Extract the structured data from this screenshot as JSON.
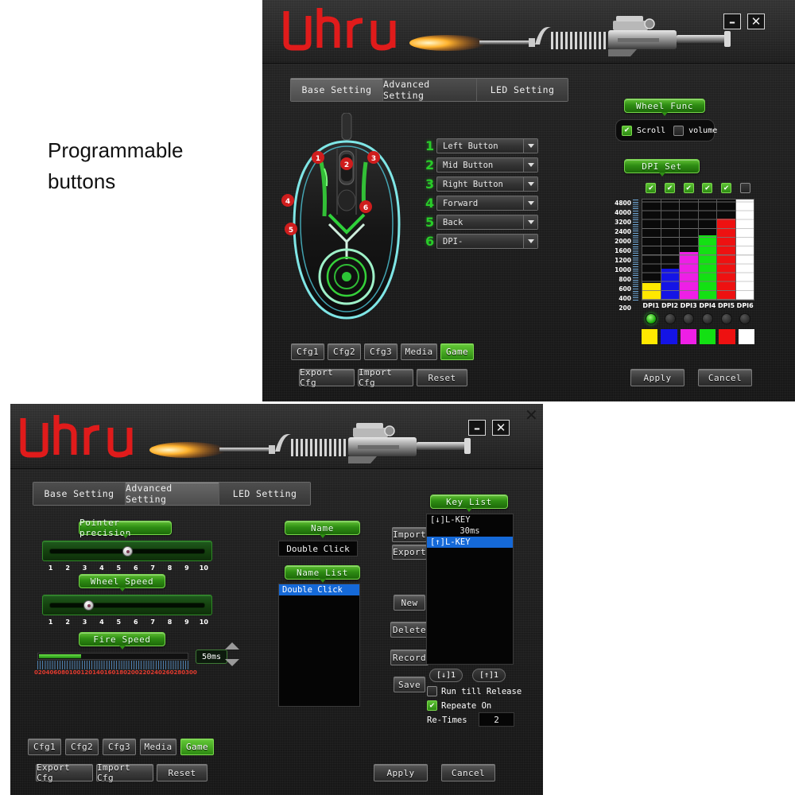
{
  "callout": {
    "line1": "Programmable",
    "line2": "buttons"
  },
  "window_top": {
    "brand": "uhru",
    "controls": {
      "minimize": "–",
      "close": "✕"
    },
    "tabs": [
      {
        "label": "Base Setting",
        "active": true
      },
      {
        "label": "Advanced Setting",
        "active": false
      },
      {
        "label": "LED Setting",
        "active": false
      }
    ],
    "button_rows": [
      {
        "num": "1",
        "value": "Left Button"
      },
      {
        "num": "2",
        "value": "Mid Button"
      },
      {
        "num": "3",
        "value": "Right Button"
      },
      {
        "num": "4",
        "value": "Forward"
      },
      {
        "num": "5",
        "value": "Back"
      },
      {
        "num": "6",
        "value": "DPI-"
      }
    ],
    "mouse_markers": [
      "1",
      "2",
      "3",
      "4",
      "5",
      "6"
    ],
    "wheel_func": {
      "title": "Wheel Func",
      "scroll_label": "Scroll",
      "scroll_checked": true,
      "volume_label": "volume",
      "volume_checked": false
    },
    "dpi_set": {
      "title": "DPI Set"
    },
    "footer": {
      "cfg_buttons": [
        {
          "label": "Cfg1",
          "active": false
        },
        {
          "label": "Cfg2",
          "active": false
        },
        {
          "label": "Cfg3",
          "active": false
        },
        {
          "label": "Media",
          "active": false
        },
        {
          "label": "Game",
          "active": true
        }
      ],
      "export_cfg": "Export Cfg",
      "import_cfg": "Import Cfg",
      "reset": "Reset",
      "apply": "Apply",
      "cancel": "Cancel"
    }
  },
  "window_bottom": {
    "brand": "uhru",
    "controls": {
      "minimize": "–",
      "close": "✕",
      "outer_close": "✕"
    },
    "tabs": [
      {
        "label": "Base Setting",
        "active": false
      },
      {
        "label": "Advanced Setting",
        "active": true
      },
      {
        "label": "LED Setting",
        "active": false
      }
    ],
    "pointer_precision": {
      "title": "Pointer precision",
      "value": 5,
      "min": 1,
      "max": 10,
      "ticks": [
        "1",
        "2",
        "3",
        "4",
        "5",
        "6",
        "7",
        "8",
        "9",
        "10"
      ]
    },
    "wheel_speed": {
      "title": "Wheel Speed",
      "value": 3,
      "min": 1,
      "max": 10,
      "ticks": [
        "1",
        "2",
        "3",
        "4",
        "5",
        "6",
        "7",
        "8",
        "9",
        "10"
      ]
    },
    "fire_speed": {
      "title": "Fire Speed",
      "value_label": "50ms",
      "value": 50,
      "min": 0,
      "max": 300,
      "ticks": [
        "0",
        "20",
        "40",
        "60",
        "80",
        "100",
        "120",
        "140",
        "160",
        "180",
        "200",
        "220",
        "240",
        "260",
        "280",
        "300"
      ]
    },
    "name_panel": {
      "title": "Name",
      "value": "Double Click",
      "import_label": "Import",
      "export_label": "Export"
    },
    "name_list": {
      "title": "Name List",
      "items": [
        {
          "label": "Double Click",
          "selected": true
        }
      ],
      "buttons": [
        "New",
        "Delete",
        "Record",
        "Save"
      ]
    },
    "key_list": {
      "title": "Key List",
      "items": [
        {
          "label": "[↓]L-KEY",
          "selected": false,
          "center": false
        },
        {
          "label": "30ms",
          "selected": false,
          "center": true
        },
        {
          "label": "[↑]L-KEY",
          "selected": true,
          "center": false
        }
      ],
      "down_btn": "[↓]1",
      "up_btn": "[↑]1",
      "run_till_release": {
        "label": "Run till Release",
        "checked": false
      },
      "repeate_on": {
        "label": "Repeate On",
        "checked": true
      },
      "re_times_label": "Re-Times",
      "re_times_value": "2"
    },
    "footer": {
      "cfg_buttons": [
        {
          "label": "Cfg1",
          "active": false
        },
        {
          "label": "Cfg2",
          "active": false
        },
        {
          "label": "Cfg3",
          "active": false
        },
        {
          "label": "Media",
          "active": false
        },
        {
          "label": "Game",
          "active": true
        }
      ],
      "export_cfg": "Export Cfg",
      "import_cfg": "Import Cfg",
      "reset": "Reset",
      "apply": "Apply",
      "cancel": "Cancel"
    }
  },
  "chart_data": {
    "type": "bar",
    "title": "DPI Set",
    "categories": [
      "DPI1",
      "DPI2",
      "DPI3",
      "DPI4",
      "DPI5",
      "DPI6"
    ],
    "values": [
      600,
      1000,
      1600,
      2400,
      3200,
      4800
    ],
    "colors": [
      "#ffe800",
      "#1414e6",
      "#ee1fe6",
      "#13e013",
      "#ee1111",
      "#ffffff"
    ],
    "enabled": [
      true,
      true,
      true,
      true,
      true,
      false
    ],
    "selected_index": 0,
    "ylabel": "",
    "xlabel": "",
    "ylim": [
      0,
      4800
    ],
    "ytick_labels": [
      "4800",
      "4000",
      "3200",
      "2400",
      "2000",
      "1600",
      "1200",
      "1000",
      "800",
      "600",
      "400",
      "200"
    ],
    "grid": true,
    "legend": "none"
  }
}
